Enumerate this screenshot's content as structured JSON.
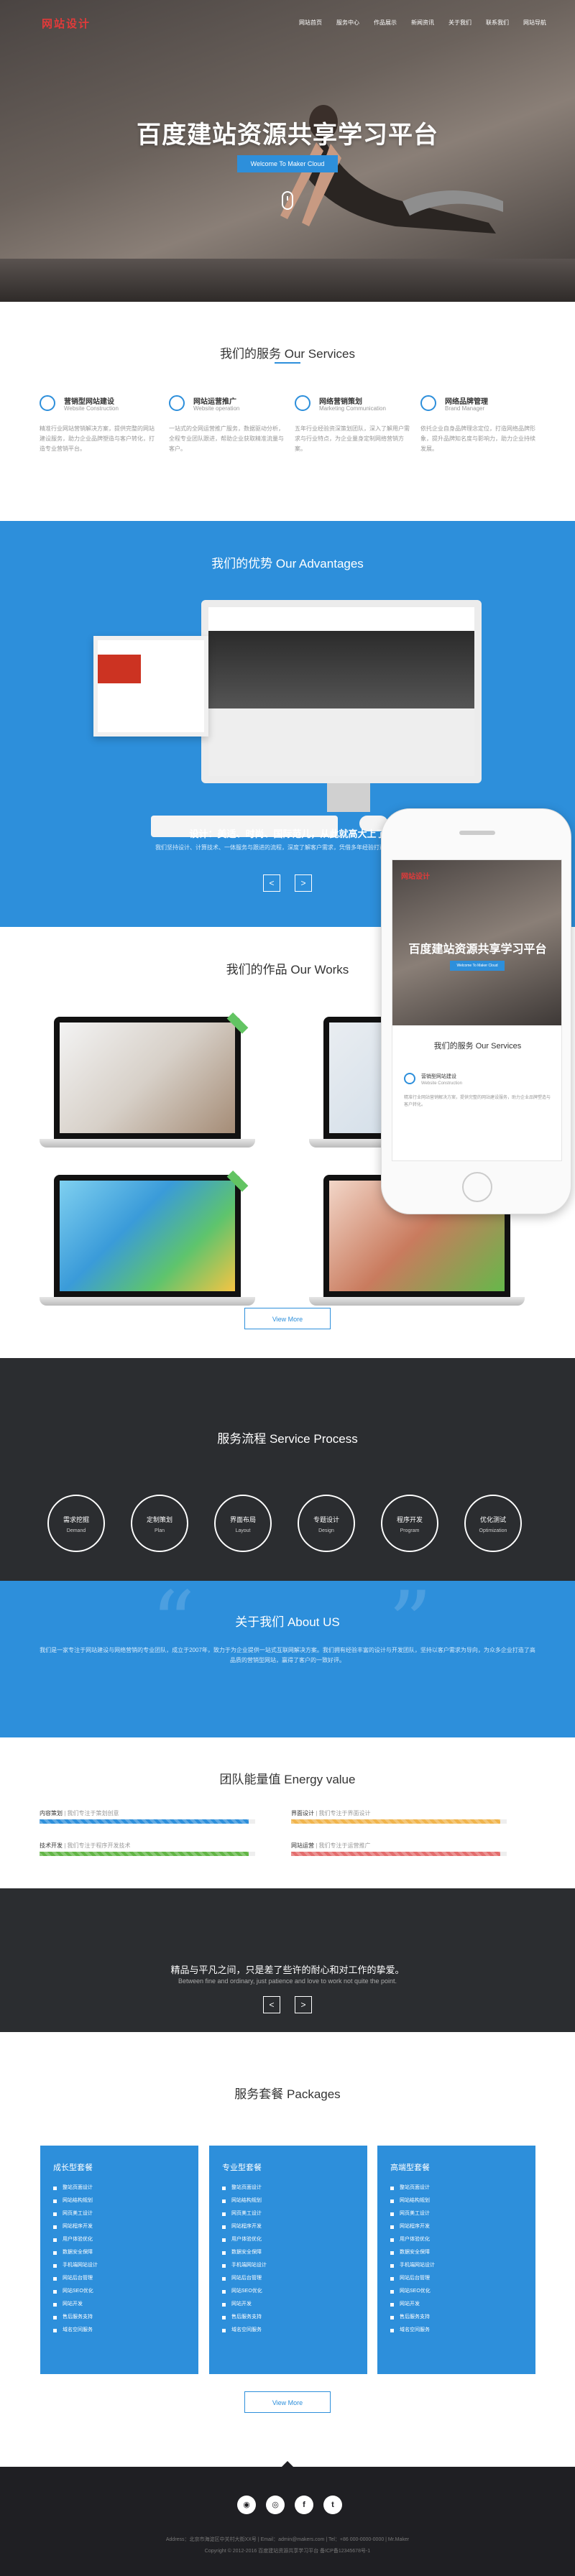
{
  "colors": {
    "accent": "#2d8fdb",
    "dark": "#2b2d30",
    "logo": "#e23a3a"
  },
  "header": {
    "logo": "网站设计",
    "menu": [
      "网站首页",
      "服务中心",
      "作品展示",
      "新闻资讯",
      "关于我们",
      "联系我们",
      "网站导航"
    ]
  },
  "hero": {
    "title": "百度建站资源共享学习平台",
    "button": "Welcome To Maker Cloud"
  },
  "services": {
    "title": "我们的服务 Our Services",
    "items": [
      {
        "cn": "营销型网站建设",
        "en": "Website Construction",
        "icon": "monitor-icon",
        "desc": "精准行业网站营销解决方案，提供完整的网站建设服务，助力企业品牌塑造与客户转化，打造专业营销平台。"
      },
      {
        "cn": "网站运营推广",
        "en": "Website operation",
        "icon": "chart-icon",
        "desc": "一站式的全网运营推广服务，数据驱动分析，全程专业团队跟进，帮助企业获取精准流量与客户。"
      },
      {
        "cn": "网络营销策划",
        "en": "Marketing Communication",
        "icon": "compass-icon",
        "desc": "五年行业经验资深策划团队，深入了解用户需求与行业特点，为企业量身定制网络营销方案。"
      },
      {
        "cn": "网络品牌管理",
        "en": "Brand Manager",
        "icon": "refresh-icon",
        "desc": "依托企业自身品牌理念定位，打造网络品牌形象，提升品牌知名度与影响力，助力企业持续发展。"
      }
    ]
  },
  "advantages": {
    "title": "我们的优势 Our Advantages",
    "tagline": "设计：美适、时尚、国际范儿，从此就高大上了",
    "desc": "我们坚持设计、计算技术、一体服务与跟进的流程，深度了解客户需求，凭借多年经验打造高品质网站。",
    "prev": "<",
    "next": ">"
  },
  "works": {
    "title": "我们的作品 Our Works",
    "more": "View More"
  },
  "phone": {
    "logo": "网站设计",
    "title": "百度建站资源共享学习平台",
    "button": "Welcome To Maker Cloud",
    "section": "我们的服务 Our Services",
    "svc_cn": "营销型网站建设",
    "svc_en": "Website Construction",
    "svc_desc": "精准行业网站营销解决方案，提供完整的网站建设服务，助力企业品牌塑造与客户转化。"
  },
  "process": {
    "title": "服务流程 Service Process",
    "steps": [
      {
        "cn": "需求挖掘",
        "en": "Demand"
      },
      {
        "cn": "定制策划",
        "en": "Plan"
      },
      {
        "cn": "界面布局",
        "en": "Layout"
      },
      {
        "cn": "专题设计",
        "en": "Design"
      },
      {
        "cn": "程序开发",
        "en": "Program"
      },
      {
        "cn": "优化测试",
        "en": "Optimization"
      }
    ]
  },
  "about": {
    "title": "关于我们 About US",
    "desc": "我们是一家专注于网站建设与网络营销的专业团队，成立于2007年，致力于为企业提供一站式互联网解决方案。我们拥有经验丰富的设计与开发团队，坚持以客户需求为导向，为众多企业打造了高品质的营销型网站，赢得了客户的一致好评。"
  },
  "energy": {
    "title": "团队能量值 Energy value",
    "bars": [
      {
        "label": "内容策划",
        "note": "| 我们专注于策划创意",
        "value": 0.97,
        "color": "#2d8fdb"
      },
      {
        "label": "界面设计",
        "note": "| 我们专注于界面设计",
        "value": 0.97,
        "color": "#f0b44c"
      },
      {
        "label": "技术开发",
        "note": "| 我们专注于程序开发技术",
        "value": 0.97,
        "color": "#62b545"
      },
      {
        "label": "网站运营",
        "note": "| 我们专注于运营推广",
        "value": 0.97,
        "color": "#e36d6d"
      }
    ]
  },
  "quote": {
    "cn": "精品与平凡之间，只是差了些许的耐心和对工作的挚爱。",
    "en": "Between fine and ordinary, just patience and love to work not quite the point.",
    "prev": "<",
    "next": ">"
  },
  "packages": {
    "title": "服务套餐 Packages",
    "more": "View More",
    "cards": [
      {
        "name": "成长型套餐",
        "features": [
          "整站页面设计",
          "网站结构规划",
          "网页美工设计",
          "网站程序开发",
          "用户体验优化",
          "数据安全保障",
          "手机端网站设计",
          "网站后台管理",
          "网站SEO优化",
          "网站开发",
          "售后服务支持",
          "域名空间服务"
        ]
      },
      {
        "name": "专业型套餐",
        "features": [
          "整站页面设计",
          "网站结构规划",
          "网页美工设计",
          "网站程序开发",
          "用户体验优化",
          "数据安全保障",
          "手机端网站设计",
          "网站后台管理",
          "网站SEO优化",
          "网站开发",
          "售后服务支持",
          "域名空间服务"
        ]
      },
      {
        "name": "高端型套餐",
        "features": [
          "整站页面设计",
          "网站结构规划",
          "网页美工设计",
          "网站程序开发",
          "用户体验优化",
          "数据安全保障",
          "手机端网站设计",
          "网站后台管理",
          "网站SEO优化",
          "网站开发",
          "售后服务支持",
          "域名空间服务"
        ]
      }
    ]
  },
  "footer": {
    "social": [
      "qq",
      "wechat",
      "f",
      "t"
    ],
    "line1": "Address：北京市海淀区中关村大街XX号 | Email：admin@makers.com | Tel：+86 000-0000-0000 | Mr.Maker",
    "line2": "Copyright © 2012-2016 百度建站资源共享学习平台 备ICP备12345678号-1"
  }
}
